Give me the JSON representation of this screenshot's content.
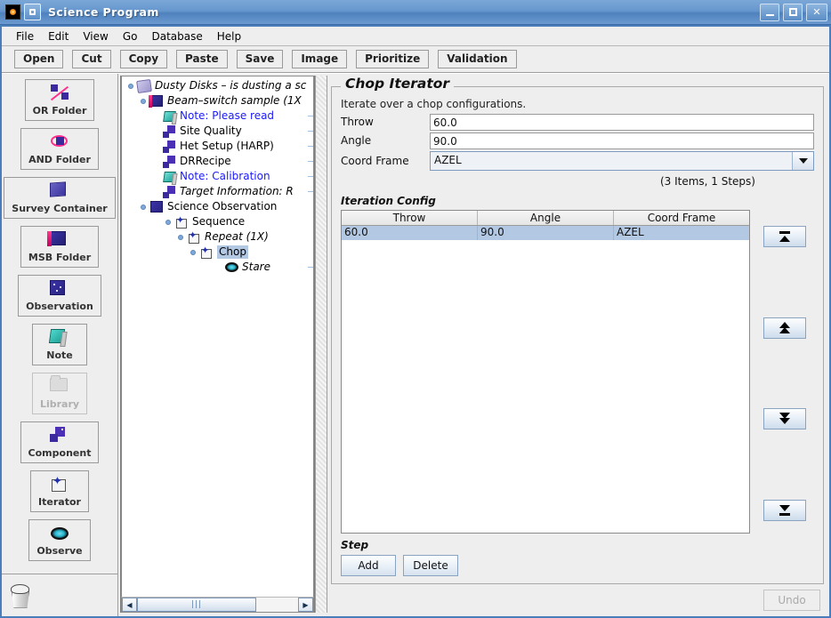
{
  "window": {
    "title": "Science Program",
    "app_icon": "program-icon",
    "controls": {
      "minimize": "minimize-icon",
      "maximize": "maximize-icon",
      "close": "close-icon"
    }
  },
  "menubar": {
    "items": [
      "File",
      "Edit",
      "View",
      "Go",
      "Database",
      "Help"
    ]
  },
  "toolbar": {
    "buttons": [
      "Open",
      "Cut",
      "Copy",
      "Paste",
      "Save",
      "Image",
      "Prioritize",
      "Validation"
    ]
  },
  "palette": {
    "items": [
      {
        "label": "OR Folder",
        "icon": "or-folder-icon",
        "disabled": false,
        "wide": false
      },
      {
        "label": "AND Folder",
        "icon": "and-folder-icon",
        "disabled": false,
        "wide": false
      },
      {
        "label": "Survey Container",
        "icon": "survey-container-icon",
        "disabled": false,
        "wide": true
      },
      {
        "label": "MSB Folder",
        "icon": "msb-folder-icon",
        "disabled": false,
        "wide": false
      },
      {
        "label": "Observation",
        "icon": "observation-icon",
        "disabled": false,
        "wide": false
      },
      {
        "label": "Note",
        "icon": "note-icon",
        "disabled": false,
        "wide": false
      },
      {
        "label": "Library",
        "icon": "library-icon",
        "disabled": true,
        "wide": false
      },
      {
        "label": "Component",
        "icon": "component-icon",
        "disabled": false,
        "wide": false
      },
      {
        "label": "Iterator",
        "icon": "iterator-icon",
        "disabled": false,
        "wide": false
      },
      {
        "label": "Observe",
        "icon": "observe-icon",
        "disabled": false,
        "wide": false
      }
    ],
    "trash": "trash-icon"
  },
  "tree": {
    "nodes": [
      {
        "label": "Dusty Disks – is dusting a sc",
        "indent": 0,
        "icon": "science-program-icon",
        "style": "italic",
        "expanded": true,
        "selected": false
      },
      {
        "label": "Beam–switch sample (1X",
        "indent": 1,
        "icon": "msb-folder-icon",
        "style": "italic",
        "expanded": true,
        "selected": false
      },
      {
        "label": "Note: Please read",
        "indent": 2,
        "icon": "note-icon",
        "style": "note",
        "expanded": false,
        "selected": false
      },
      {
        "label": "Site Quality",
        "indent": 2,
        "icon": "component-icon",
        "style": "plain",
        "expanded": false,
        "selected": false
      },
      {
        "label": "Het Setup (HARP)",
        "indent": 2,
        "icon": "component-icon",
        "style": "plain",
        "expanded": false,
        "selected": false
      },
      {
        "label": "DRRecipe",
        "indent": 2,
        "icon": "component-icon",
        "style": "plain",
        "expanded": false,
        "selected": false
      },
      {
        "label": "Note: Calibration",
        "indent": 2,
        "icon": "note-icon",
        "style": "note",
        "expanded": false,
        "selected": false
      },
      {
        "label": "Target Information: R",
        "indent": 2,
        "icon": "component-icon",
        "style": "italic",
        "expanded": false,
        "selected": false
      },
      {
        "label": "Science Observation",
        "indent": 2,
        "icon": "observation-icon",
        "style": "plain",
        "expanded": true,
        "selected": false
      },
      {
        "label": "Sequence",
        "indent": 3,
        "icon": "iterator-icon",
        "style": "plain",
        "expanded": false,
        "selected": false
      },
      {
        "label": "Repeat (1X)",
        "indent": 4,
        "icon": "iterator-icon",
        "style": "italic",
        "expanded": true,
        "selected": false
      },
      {
        "label": "Chop",
        "indent": 5,
        "icon": "iterator-icon",
        "style": "plain",
        "expanded": true,
        "selected": true
      },
      {
        "label": "Stare",
        "indent": 6,
        "icon": "observe-eye-icon",
        "style": "italic",
        "expanded": false,
        "selected": false
      }
    ],
    "hscrollbar": {
      "left_arrow": "◀",
      "right_arrow": "▶",
      "grip": "|||"
    }
  },
  "editor": {
    "group_title": "Chop Iterator",
    "hint": "Iterate over a chop configurations.",
    "fields": [
      {
        "label": "Throw",
        "value": "60.0",
        "type": "text"
      },
      {
        "label": "Angle",
        "value": "90.0",
        "type": "text"
      },
      {
        "label": "Coord Frame",
        "value": "AZEL",
        "type": "combo"
      }
    ],
    "counts": "(3 Items, 1 Steps)",
    "iteration_config": {
      "title": "Iteration Config",
      "columns": [
        "Throw",
        "Angle",
        "Coord Frame"
      ],
      "rows": [
        [
          "60.0",
          "90.0",
          "AZEL"
        ]
      ]
    },
    "move_buttons": [
      {
        "name": "move-to-top-button",
        "icon": "move-to-top-icon"
      },
      {
        "name": "move-up-button",
        "icon": "move-up-icon"
      },
      {
        "name": "move-down-button",
        "icon": "move-down-icon"
      },
      {
        "name": "move-to-bottom-button",
        "icon": "move-to-bottom-icon"
      }
    ],
    "step": {
      "title": "Step",
      "add_label": "Add",
      "delete_label": "Delete"
    },
    "undo_label": "Undo"
  },
  "colors": {
    "title_bar": "#5d8fc8",
    "selection": "#b3c8e3",
    "note_text": "#1a1aff",
    "panel_bg": "#eeeeee"
  }
}
